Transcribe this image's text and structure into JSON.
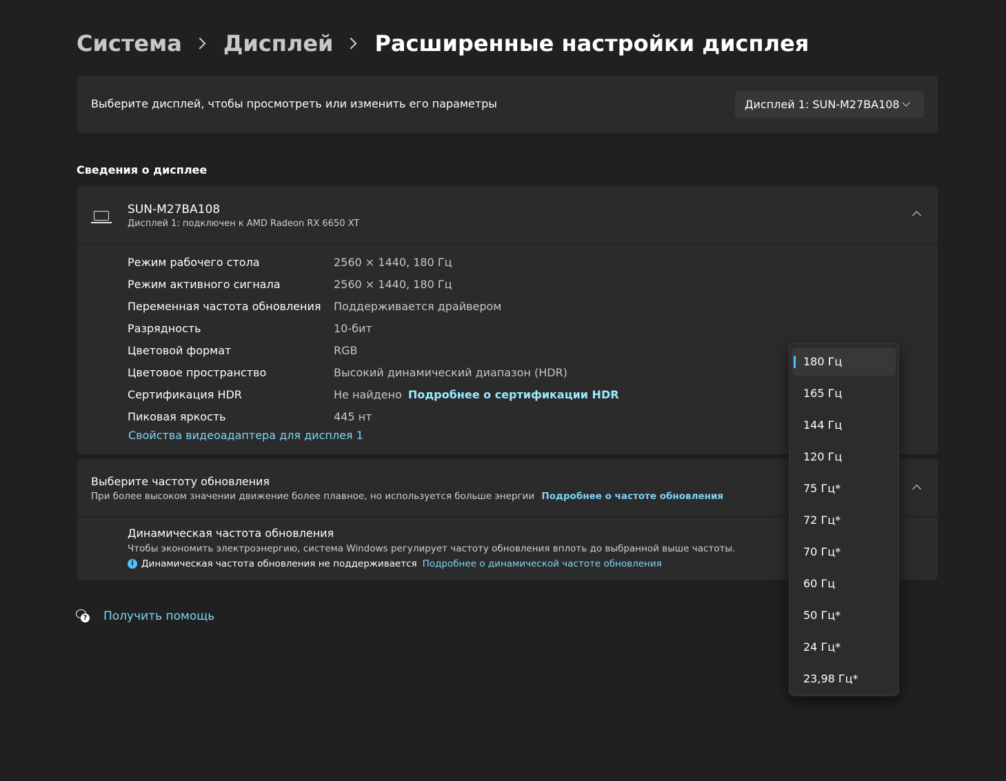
{
  "breadcrumb": {
    "item1": "Система",
    "item2": "Дисплей",
    "current": "Расширенные настройки дисплея"
  },
  "display_select": {
    "label": "Выберите дисплей, чтобы просмотреть или изменить его параметры",
    "selected": "Дисплей 1: SUN-M27BA108"
  },
  "section_title": "Сведения о дисплее",
  "display_info": {
    "name": "SUN-M27BA108",
    "subtitle": "Дисплей 1: подключен к AMD Radeon RX 6650 XT",
    "rows": [
      {
        "label": "Режим рабочего стола",
        "value": "2560 × 1440, 180 Гц"
      },
      {
        "label": "Режим активного сигнала",
        "value": "2560 × 1440, 180 Гц"
      },
      {
        "label": "Переменная частота обновления",
        "value": "Поддерживается драйвером"
      },
      {
        "label": "Разрядность",
        "value": "10-бит"
      },
      {
        "label": "Цветовой формат",
        "value": "RGB"
      },
      {
        "label": "Цветовое пространство",
        "value": "Высокий динамический диапазон (HDR)"
      },
      {
        "label": "Сертификация HDR",
        "value": "Не найдено",
        "link": "Подробнее о сертификации HDR"
      },
      {
        "label": "Пиковая яркость",
        "value": "445 нт"
      }
    ],
    "adapter_link": "Свойства видеоадаптера для дисплея 1"
  },
  "refresh": {
    "title": "Выберите частоту обновления",
    "description": "При более высоком значении движение более плавное, но используется больше энергии",
    "learn_more": "Подробнее о частоте обновления",
    "dynamic_title": "Динамическая частота обновления",
    "dynamic_desc": "Чтобы экономить электроэнергию, система Windows регулирует частоту обновления вплоть до выбранной выше частоты.",
    "dynamic_note": "Динамическая частота обновления не поддерживается",
    "dynamic_link": "Подробнее о динамической частоте обновления"
  },
  "rate_menu": {
    "selected": "180 Гц",
    "options": [
      "180 Гц",
      "165 Гц",
      "144 Гц",
      "120 Гц",
      "75 Гц*",
      "72 Гц*",
      "70 Гц*",
      "60 Гц",
      "50 Гц*",
      "24 Гц*",
      "23,98 Гц*"
    ]
  },
  "help": {
    "label": "Получить помощь"
  },
  "colors": {
    "background": "#202020",
    "card": "#2b2b2b",
    "accent": "#4cc2ff",
    "link": "#7fd4f7"
  }
}
